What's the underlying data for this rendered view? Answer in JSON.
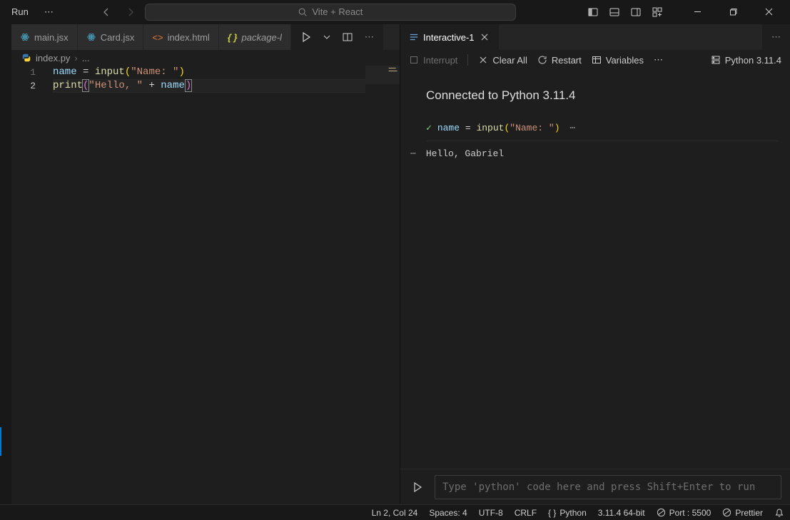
{
  "titlebar": {
    "menu": "Run",
    "search_placeholder": "Vite + React"
  },
  "tabs_left": [
    {
      "label": "main.jsx",
      "icon": "react",
      "active": false
    },
    {
      "label": "Card.jsx",
      "icon": "react",
      "active": false
    },
    {
      "label": "index.html",
      "icon": "html",
      "active": false
    },
    {
      "label": "package-l",
      "icon": "json",
      "active": false,
      "mod": true
    }
  ],
  "tabs_right": [
    {
      "label": "Interactive-1",
      "active": true
    }
  ],
  "breadcrumb": {
    "file": "index.py",
    "rest": "..."
  },
  "code": {
    "lines": [
      {
        "n": "1"
      },
      {
        "n": "2"
      }
    ],
    "l1": {
      "var": "name",
      "op1": " = ",
      "fn": "input",
      "br": "(",
      "str": "\"Name: \"",
      "br2": ")"
    },
    "l2": {
      "fn": "print",
      "br": "(",
      "str": "\"Hello, \"",
      "op": " + ",
      "var": "name",
      "br2": ")"
    }
  },
  "iw_toolbar": {
    "interrupt": "Interrupt",
    "clear": "Clear All",
    "restart": "Restart",
    "variables": "Variables",
    "kernel": "Python 3.11.4"
  },
  "iw": {
    "connected": "Connected to Python 3.11.4",
    "cell_code": "name = input(\"Name: \")",
    "cell_code_tokens": {
      "var": "name",
      "eq": " = ",
      "fn": "input",
      "p1": "(",
      "s": "\"Name: \"",
      "p2": ")"
    },
    "output": "Hello, Gabriel",
    "input_placeholder": "Type 'python' code here and press Shift+Enter to run"
  },
  "status": {
    "lncol": "Ln 2, Col 24",
    "spaces": "Spaces: 4",
    "enc": "UTF-8",
    "eol": "CRLF",
    "lang": "Python",
    "kernel": "3.11.4 64-bit",
    "port": "Port : 5500",
    "prettier": "Prettier"
  }
}
